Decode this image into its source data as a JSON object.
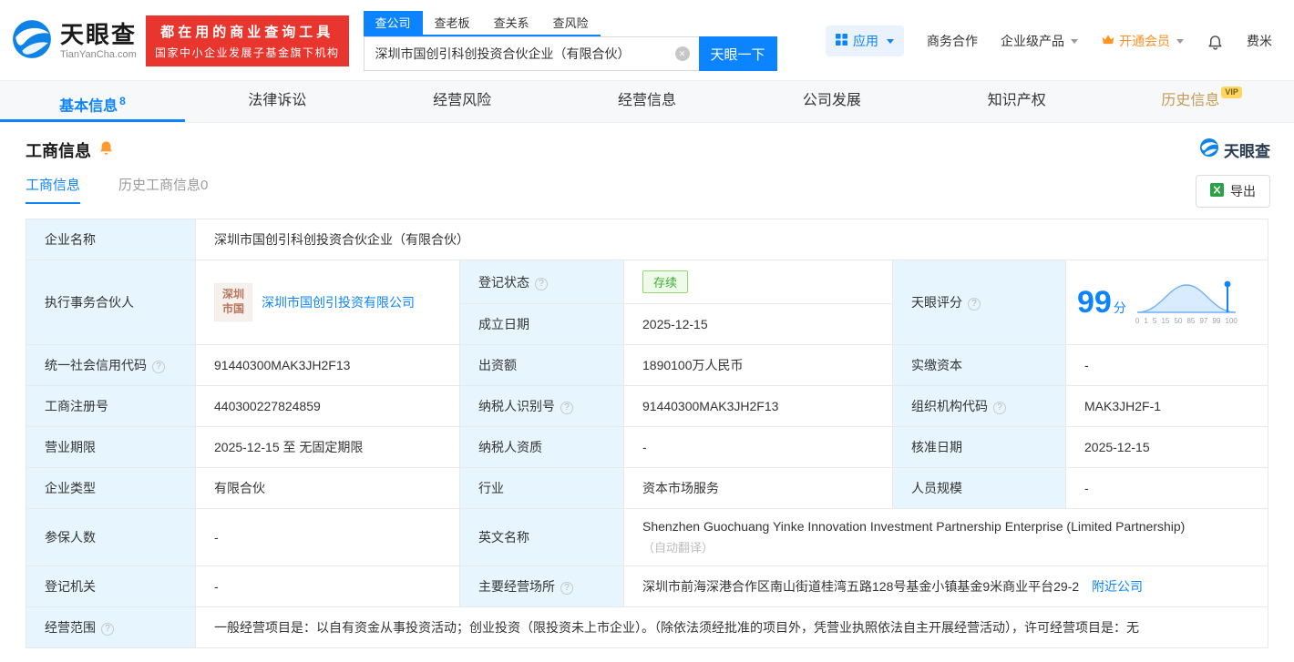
{
  "brand": {
    "name": "天眼查",
    "domain": "TianYanCha.com",
    "slogan_line1": "都在用的商业查询工具",
    "slogan_line2": "国家中小企业发展子基金旗下机构"
  },
  "search": {
    "tabs": [
      "查公司",
      "查老板",
      "查关系",
      "查风险"
    ],
    "query": "深圳市国创引科创投资合伙企业（有限合伙）",
    "button_label": "天眼一下"
  },
  "top_menu": {
    "apps": "应用",
    "cooperation": "商务合作",
    "enterprise": "企业级产品",
    "vip": "开通会员",
    "user": "费米"
  },
  "nav_tabs": [
    {
      "label": "基本信息",
      "count": "8"
    },
    {
      "label": "法律诉讼"
    },
    {
      "label": "经营风险"
    },
    {
      "label": "经营信息"
    },
    {
      "label": "公司发展"
    },
    {
      "label": "知识产权"
    },
    {
      "label": "历史信息",
      "badge": "VIP"
    }
  ],
  "section": {
    "title": "工商信息",
    "watermark": "天眼查"
  },
  "subtabs": {
    "current": "工商信息",
    "history": "历史工商信息0",
    "export_label": "导出"
  },
  "colors": {
    "primary_blue": "#0d84ff",
    "brand_red": "#e8352e",
    "status_green": "#3fae34",
    "label_cell_bg": "#e7f5fe",
    "vip_gold": "#c49a52"
  },
  "info": {
    "company_name_label": "企业名称",
    "company_name": "深圳市国创引科创投资合伙企业（有限合伙）",
    "partner_label": "执行事务合伙人",
    "partner_logo_line1": "深圳",
    "partner_logo_line2": "市国",
    "partner_name": "深圳市国创引投资有限公司",
    "status_label": "登记状态",
    "status": "存续",
    "established_label": "成立日期",
    "established": "2025-12-15",
    "score_label": "天眼评分",
    "score": "99",
    "score_unit": "分",
    "score_axis": [
      "0",
      "1",
      "5",
      "15",
      "50",
      "85",
      "97",
      "99",
      "100"
    ],
    "credit_code_label": "统一社会信用代码",
    "credit_code": "91440300MAK3JH2F13",
    "capital_label": "出资额",
    "capital": "1890100万人民币",
    "paid_capital_label": "实缴资本",
    "paid_capital": "-",
    "reg_no_label": "工商注册号",
    "reg_no": "440300227824859",
    "taxpayer_id_label": "纳税人识别号",
    "taxpayer_id": "91440300MAK3JH2F13",
    "org_code_label": "组织机构代码",
    "org_code": "MAK3JH2F-1",
    "term_label": "营业期限",
    "term": "2025-12-15 至 无固定期限",
    "taxpayer_quality_label": "纳税人资质",
    "taxpayer_quality": "-",
    "approval_date_label": "核准日期",
    "approval_date": "2025-12-15",
    "company_type_label": "企业类型",
    "company_type": "有限合伙",
    "industry_label": "行业",
    "industry": "资本市场服务",
    "staff_size_label": "人员规模",
    "staff_size": "-",
    "insured_label": "参保人数",
    "insured": "-",
    "english_name_label": "英文名称",
    "english_name": "Shenzhen Guochuang Yinke Innovation Investment Partnership Enterprise (Limited Partnership)",
    "english_name_note": "（自动翻译）",
    "authority_label": "登记机关",
    "authority": "-",
    "address_label": "主要经营场所",
    "address": "深圳市前海深港合作区南山街道桂湾五路128号基金小镇基金9米商业平台29-2",
    "nearby_link": "附近公司",
    "scope_label": "经营范围",
    "scope": "一般经营项目是：以自有资金从事投资活动；创业投资（限投资未上市企业）。（除依法须经批准的项目外，凭营业执照依法自主开展经营活动），许可经营项目是：无"
  }
}
